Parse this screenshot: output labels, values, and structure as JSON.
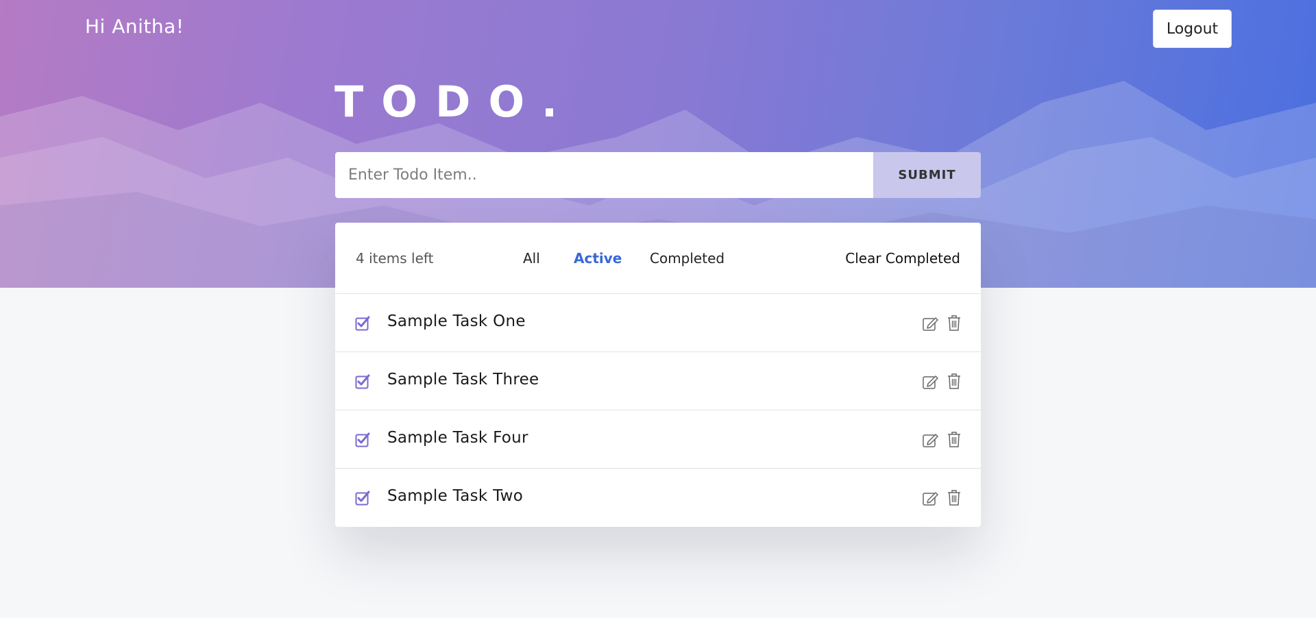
{
  "header": {
    "greeting": "Hi Anitha!",
    "logout_label": "Logout"
  },
  "app": {
    "title": "TODO."
  },
  "entry": {
    "placeholder": "Enter Todo Item..",
    "value": "",
    "submit_label": "SUBMIT"
  },
  "list_header": {
    "items_left": "4 items left",
    "filters": [
      "All",
      "Active",
      "Completed"
    ],
    "selected_filter": "Active",
    "clear_label": "Clear Completed"
  },
  "tasks": [
    {
      "text": "Sample Task One",
      "checked": true
    },
    {
      "text": "Sample Task Three",
      "checked": true
    },
    {
      "text": "Sample Task Four",
      "checked": true
    },
    {
      "text": "Sample Task Two",
      "checked": true
    }
  ],
  "icons": {
    "checkbox": "checkbox-checked-icon",
    "edit": "edit-icon",
    "delete": "trash-icon"
  },
  "colors": {
    "accent": "#3867d6",
    "check": "#7b6ad0",
    "submit_bg": "#c9c7ec"
  }
}
